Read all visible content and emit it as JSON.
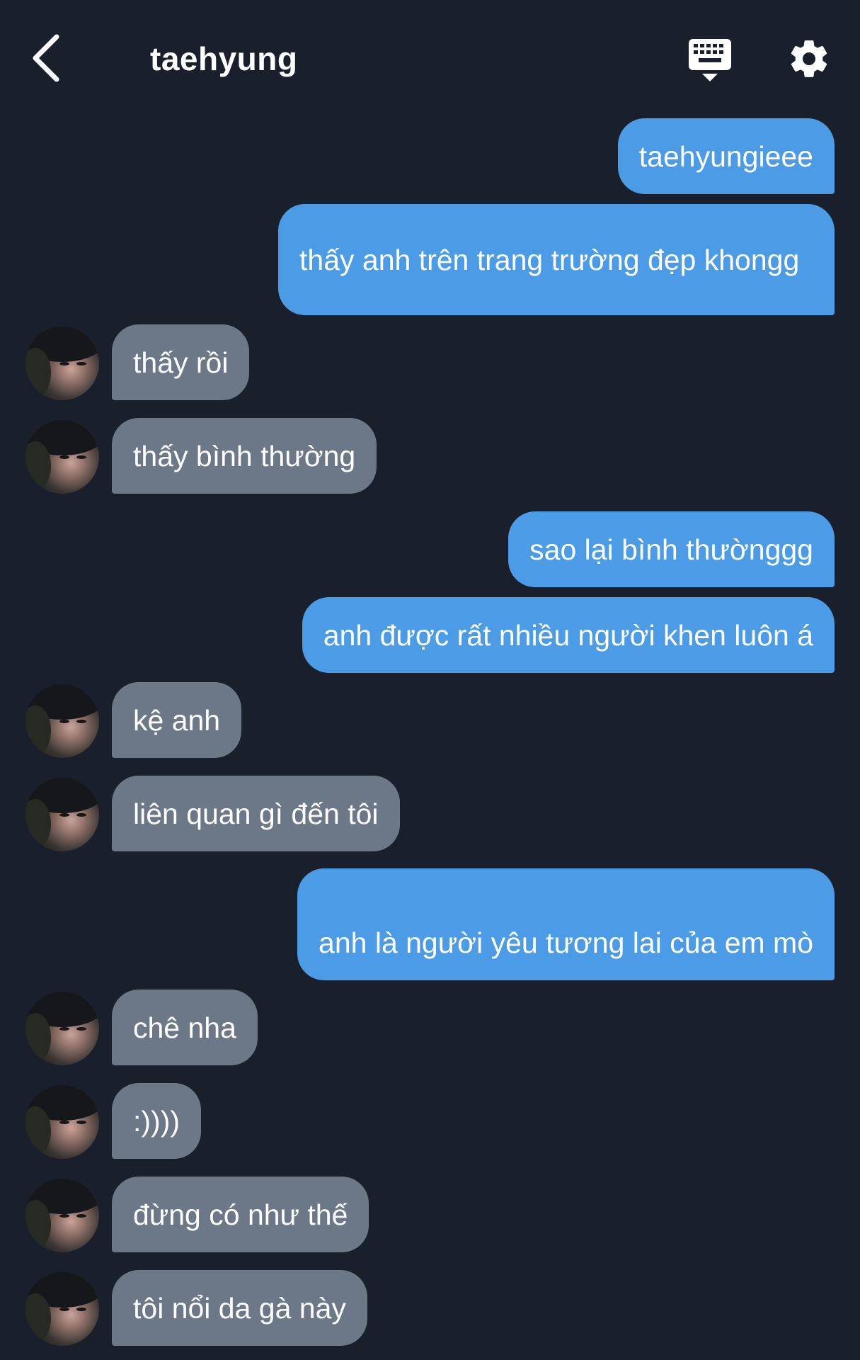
{
  "header": {
    "back_icon": "chevron-left-icon",
    "title": "taehyung",
    "keyboard_icon": "keyboard-icon",
    "settings_icon": "gear-icon"
  },
  "colors": {
    "background": "#19202b",
    "outgoing_bubble": "#4b9be6",
    "incoming_bubble": "#6c7887",
    "text": "#ffffff"
  },
  "messages": [
    {
      "side": "out",
      "text": "taehyungieee"
    },
    {
      "side": "out",
      "text": "thấy anh trên trang trường đẹp khongg"
    },
    {
      "side": "in",
      "text": "thấy rồi"
    },
    {
      "side": "in",
      "text": "thấy bình thường"
    },
    {
      "side": "out",
      "text": "sao lại bình thườnggg"
    },
    {
      "side": "out",
      "text": "anh được rất nhiều người khen luôn á"
    },
    {
      "side": "in",
      "text": "kệ anh"
    },
    {
      "side": "in",
      "text": "liên quan gì đến tôi"
    },
    {
      "side": "out",
      "text": "anh là người yêu tương lai của em mò"
    },
    {
      "side": "in",
      "text": "chê nha"
    },
    {
      "side": "in",
      "text": ":))))"
    },
    {
      "side": "in",
      "text": "đừng có như thế"
    },
    {
      "side": "in",
      "text": "tôi nổi da gà này"
    }
  ]
}
